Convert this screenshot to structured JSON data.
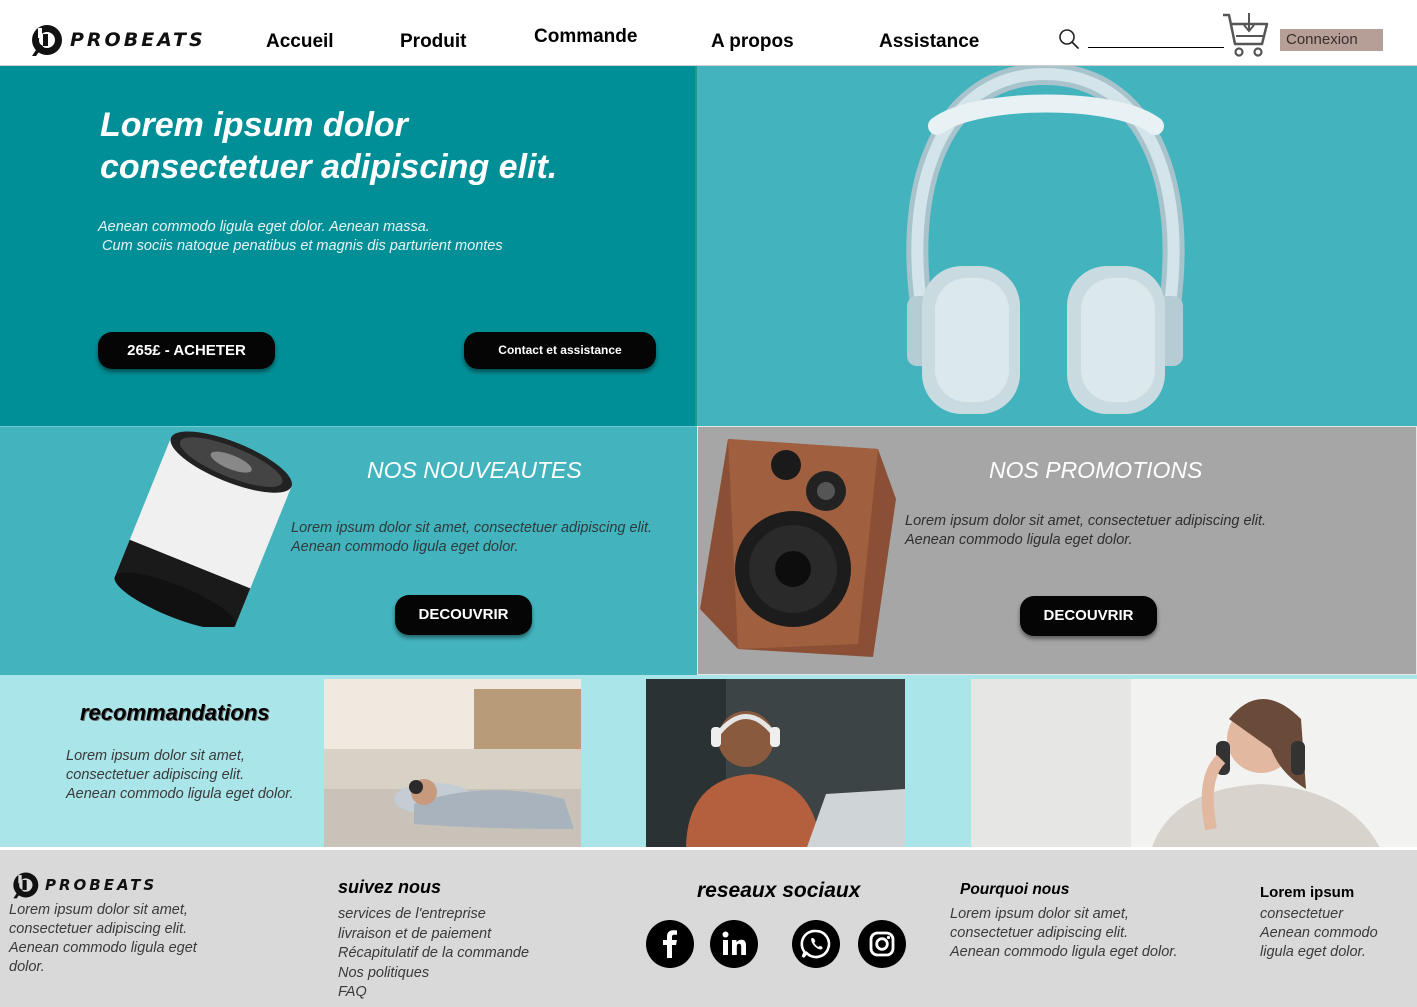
{
  "brand": {
    "name": "PROBEATS"
  },
  "nav": [
    {
      "label": "Accueil"
    },
    {
      "label": "Produit"
    },
    {
      "label": "Commande"
    },
    {
      "label": "A propos"
    },
    {
      "label": "Assistance"
    }
  ],
  "header": {
    "login_label": "Connexion",
    "icons": [
      "search-icon",
      "cart-icon"
    ]
  },
  "hero": {
    "title_line1": "Lorem ipsum dolor",
    "title_line2": "consectetuer adipiscing elit.",
    "subtitle_line1": "Aenean commodo ligula eget dolor. Aenean massa.",
    "subtitle_line2": " Cum sociis natoque penatibus et magnis dis parturient montes",
    "buy_label": "265£ - ACHETER",
    "contact_label": "Contact et assistance"
  },
  "news": {
    "title": "NOS NOUVEAUTES",
    "text_line1": "Lorem ipsum dolor sit amet, consectetuer adipiscing elit.",
    "text_line2": "Aenean commodo ligula eget dolor.",
    "button_label": "DECOUVRIR"
  },
  "promos": {
    "title": "NOS PROMOTIONS",
    "text_line1": "Lorem ipsum dolor sit amet, consectetuer adipiscing elit.",
    "text_line2": "Aenean commodo ligula eget dolor.",
    "button_label": "DECOUVRIR"
  },
  "recommendations": {
    "title": "recommandations",
    "text_line1": "Lorem ipsum dolor sit amet,",
    "text_line2": "consectetuer adipiscing elit.",
    "text_line3": "Aenean commodo ligula eget dolor."
  },
  "footer": {
    "brand": "PROBEATS",
    "about_line1": "Lorem ipsum dolor sit amet,",
    "about_line2": "consectetuer adipiscing elit.",
    "about_line3": "Aenean commodo ligula eget",
    "about_line4": "dolor.",
    "follow_title": "suivez nous",
    "follow_links": [
      {
        "label": "services de l'entreprise"
      },
      {
        "label": "livraison et de paiement"
      },
      {
        "label": "Récapitulatif de la commande"
      },
      {
        "label": "Nos politiques"
      },
      {
        "label": "FAQ"
      }
    ],
    "social_title": "reseaux sociaux",
    "social_icons": [
      "facebook-icon",
      "linkedin-icon",
      "whatsapp-icon",
      "instagram-icon"
    ],
    "why_title": "Pourquoi nous",
    "why_line1": "Lorem ipsum dolor sit amet,",
    "why_line2": "consectetuer adipiscing elit.",
    "why_line3": "Aenean commodo ligula eget dolor.",
    "extra_title": "Lorem ipsum",
    "extra_line1": "consectetuer",
    "extra_line2": "Aenean commodo",
    "extra_line3": "ligula eget dolor."
  }
}
